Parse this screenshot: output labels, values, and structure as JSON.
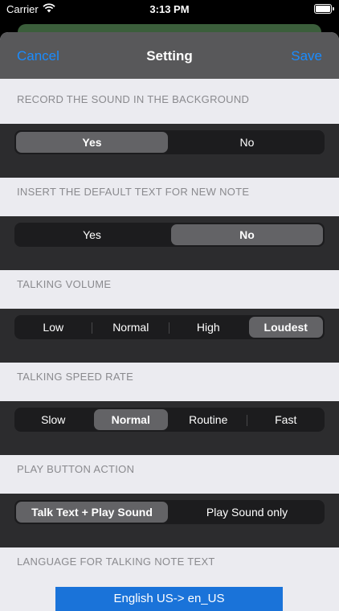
{
  "status_bar": {
    "carrier": "Carrier",
    "time": "3:13 PM"
  },
  "nav": {
    "cancel": "Cancel",
    "title": "Setting",
    "save": "Save"
  },
  "sections": [
    {
      "header": "RECORD THE SOUND IN THE BACKGROUND",
      "options": [
        "Yes",
        "No"
      ],
      "selected": 0
    },
    {
      "header": "INSERT THE DEFAULT TEXT FOR NEW NOTE",
      "options": [
        "Yes",
        "No"
      ],
      "selected": 1
    },
    {
      "header": "TALKING VOLUME",
      "options": [
        "Low",
        "Normal",
        "High",
        "Loudest"
      ],
      "selected": 3
    },
    {
      "header": "TALKING SPEED RATE",
      "options": [
        "Slow",
        "Normal",
        "Routine",
        "Fast"
      ],
      "selected": 1
    },
    {
      "header": "PLAY BUTTON ACTION",
      "options": [
        "Talk Text + Play Sound",
        "Play Sound only"
      ],
      "selected": 0
    }
  ],
  "language": {
    "header": "LANGUAGE FOR TALKING NOTE TEXT",
    "button": "English US-> en_US"
  },
  "colors": {
    "accent": "#1a8cff",
    "nav_bg": "#58585a",
    "section_body": "#2c2c2e",
    "selected_segment": "#636366"
  }
}
